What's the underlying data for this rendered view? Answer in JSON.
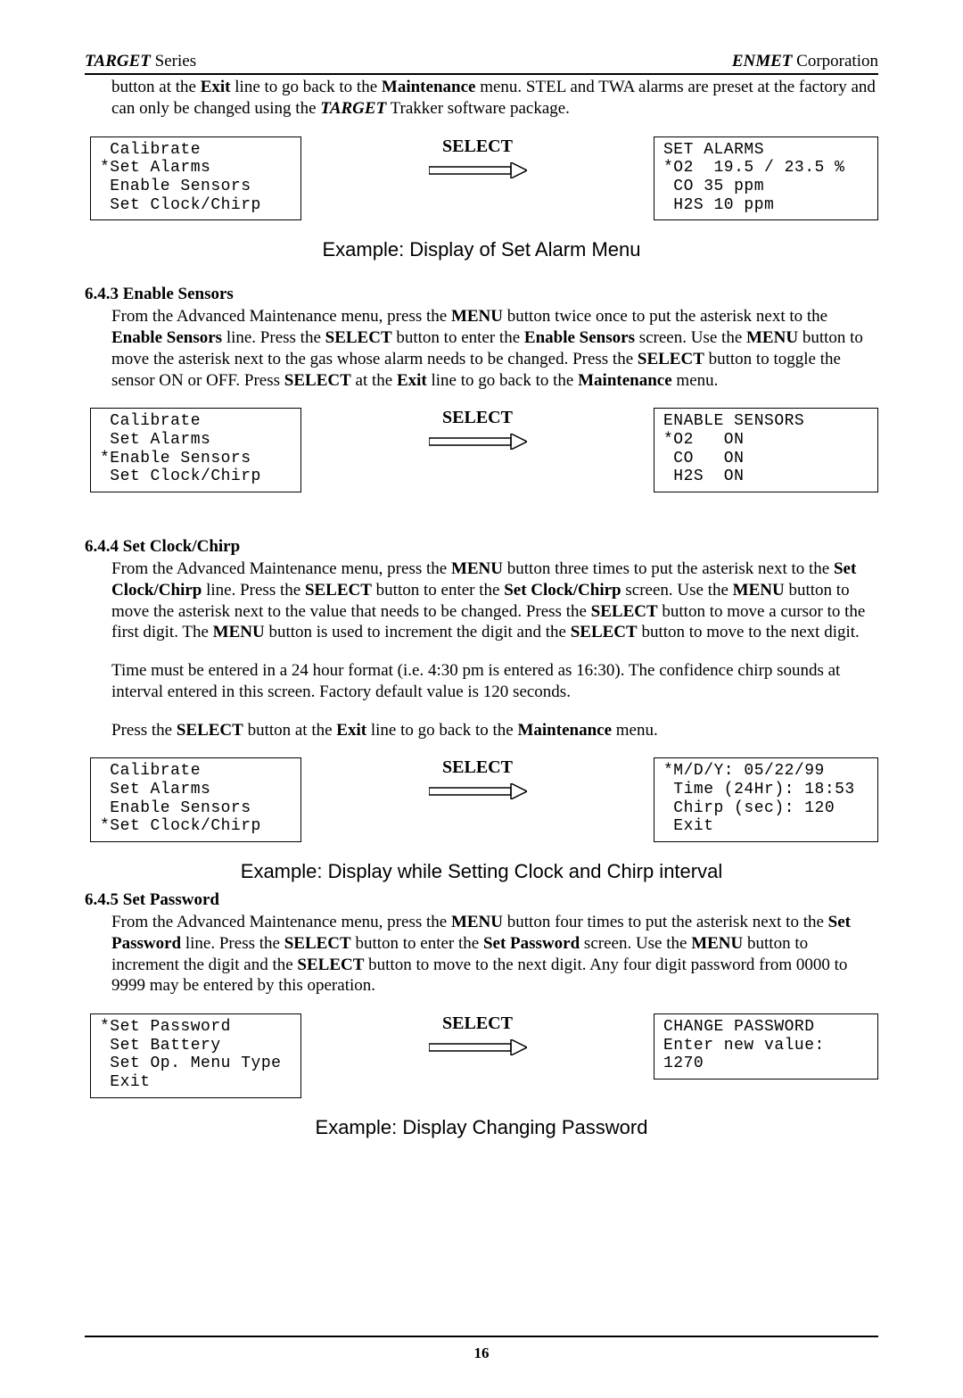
{
  "header": {
    "left_italic": "TARGET",
    "left_plain": "  Series",
    "right_italic": "ENMET",
    "right_plain": " Corporation"
  },
  "intro_para": {
    "pre": "button at the ",
    "b1": "Exit",
    "mid1": " line to go back to the ",
    "b2": "Maintenance",
    "mid2": " menu.  STEL and TWA alarms are preset at the factory and can only be changed using the ",
    "b3i": "TARGET",
    "tail": " Trakker software package."
  },
  "diag1": {
    "left": " Calibrate\n*Set Alarms\n Enable Sensors\n Set Clock/Chirp",
    "select": "SELECT",
    "right": "SET ALARMS\n*O2  19.5 / 23.5 %\n CO 35 ppm\n H2S 10 ppm"
  },
  "caption1": "Example: Display of Set Alarm Menu",
  "sec643": {
    "heading": "6.4.3 Enable Sensors",
    "p_pre": "From the Advanced Maintenance menu, press the ",
    "b1": "MENU",
    "m1": " button twice once to put the asterisk next to the ",
    "b2": "Enable Sensors",
    "m2": " line.  Press the ",
    "b3": "SELECT",
    "m3": " button to enter the ",
    "b4": "Enable Sensors",
    "m4": " screen.  Use the ",
    "b5": "MENU",
    "m5": " button to move the asterisk next to the gas whose alarm needs to be changed.  Press the ",
    "b6": "SELECT",
    "m6": " button to toggle the sensor ON or OFF.  Press ",
    "b7": "SELECT",
    "m7": " at the ",
    "b8": "Exit",
    "m8": " line to go back to the ",
    "b9": "Maintenance",
    "m9": " menu."
  },
  "diag2": {
    "left": " Calibrate\n Set Alarms\n*Enable Sensors\n Set Clock/Chirp",
    "select": "SELECT",
    "right": "ENABLE SENSORS\n*O2   ON\n CO   ON\n H2S  ON"
  },
  "sec644": {
    "heading": "6.4.4 Set Clock/Chirp",
    "p1_pre": "From the Advanced Maintenance menu, press the ",
    "b1": "MENU",
    "m1": " button three times to put the asterisk next to the ",
    "b2": "Set Clock/Chirp",
    "m2": " line.  Press the ",
    "b3": "SELECT",
    "m3": " button to enter the ",
    "b4": "Set Clock/Chirp",
    "m4": " screen.  Use the ",
    "b5": "MENU",
    "m5": " button to move the asterisk next to the value that needs to be changed.  Press the ",
    "b6": "SELECT",
    "m6": " button to move a cursor to the first digit.  The ",
    "b7": "MENU",
    "m7": " button is used to increment the digit and the ",
    "b8": "SELECT",
    "m8": " button to move to the next digit.",
    "p2": "Time must be entered in a 24 hour format (i.e. 4:30 pm is entered as 16:30).  The confidence chirp sounds at interval entered in this screen.  Factory default value is 120 seconds.",
    "p3_pre": "Press the ",
    "p3_b1": "SELECT",
    "p3_m1": " button at the ",
    "p3_b2": "Exit",
    "p3_m2": " line to go back to the ",
    "p3_b3": "Maintenance",
    "p3_m3": " menu."
  },
  "diag3": {
    "left": " Calibrate\n Set Alarms\n Enable Sensors\n*Set Clock/Chirp",
    "select": "SELECT",
    "right": "*M/D/Y: 05/22/99\n Time (24Hr): 18:53\n Chirp (sec): 120\n Exit"
  },
  "caption3": "Example: Display while Setting Clock and Chirp interval",
  "sec645": {
    "heading": "6.4.5 Set Password",
    "p_pre": "From the Advanced Maintenance menu, press the ",
    "b1": "MENU",
    "m1": " button four times to put the asterisk next to the ",
    "b2": "Set Password",
    "m2": " line.  Press the ",
    "b3": "SELECT",
    "m3": " button to enter the ",
    "b4": "Set Password",
    "m4": " screen.  Use the ",
    "b5": "MENU",
    "m5": " button to increment the digit and the ",
    "b6": "SELECT",
    "m6": " button to move to the next digit.  Any four digit password from 0000 to 9999 may be entered by this operation."
  },
  "diag4": {
    "left": "*Set Password\n Set Battery\n Set Op. Menu Type\n Exit",
    "select": "SELECT",
    "right": "CHANGE PASSWORD\nEnter new value:\n1270"
  },
  "caption4": "Example: Display Changing Password",
  "page_num": "16"
}
